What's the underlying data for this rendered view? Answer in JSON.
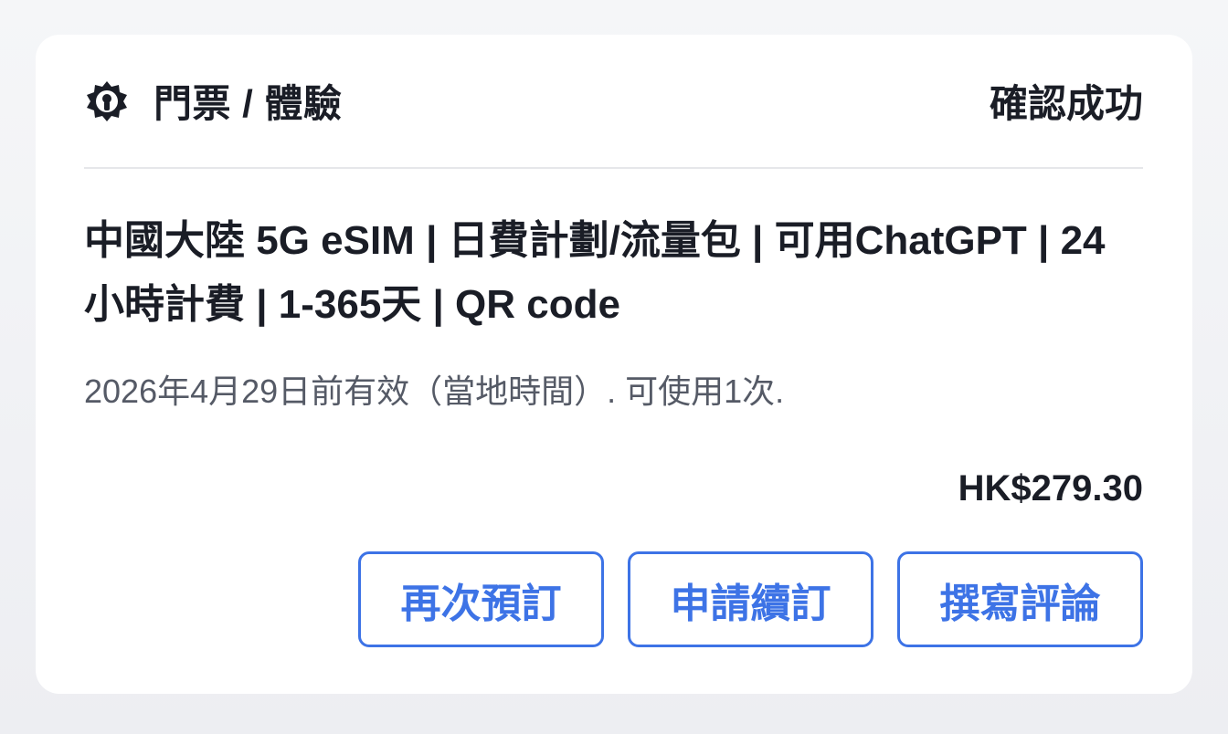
{
  "header": {
    "category_icon": "ticket-gear-icon",
    "category_label": "門票 / 體驗",
    "status": "確認成功"
  },
  "product": {
    "title": "中國大陸 5G eSIM | 日費計劃/流量包 | 可用ChatGPT | 24小時計費 | 1-365天 | QR code",
    "validity": "2026年4月29日前有效（當地時間）. 可使用1次.",
    "price": "HK$279.30"
  },
  "actions": {
    "rebook_label": "再次預訂",
    "renew_label": "申請續訂",
    "review_label": "撰寫評論"
  },
  "colors": {
    "accent": "#3d73e6",
    "text": "#1a1d26",
    "muted": "#555a66"
  }
}
